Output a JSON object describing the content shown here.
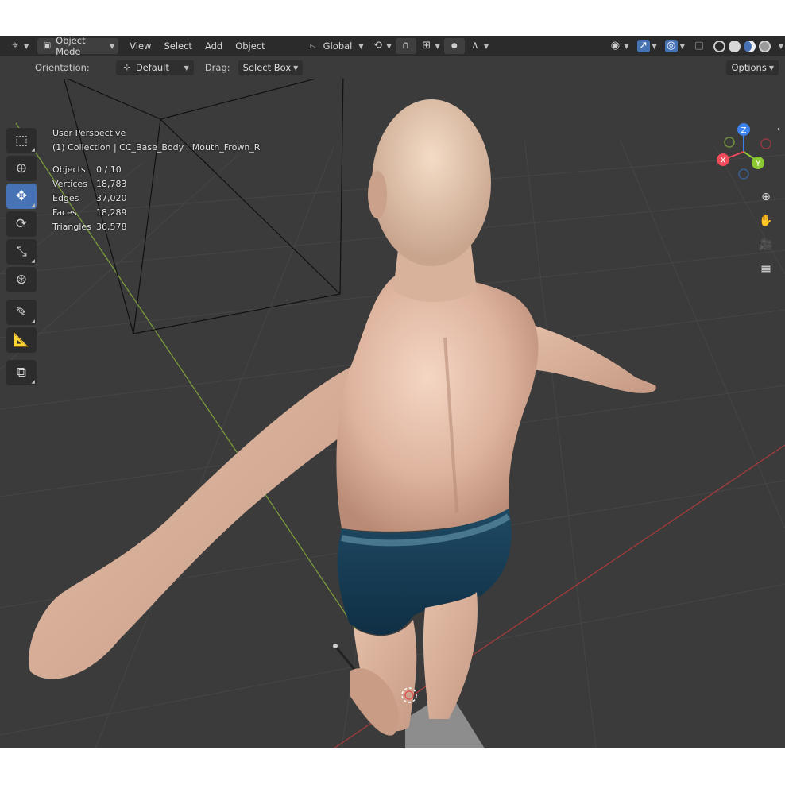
{
  "header": {
    "mode": "Object Mode",
    "menus": [
      "View",
      "Select",
      "Add",
      "Object"
    ],
    "transform_orientation": "Global",
    "options_label": "Options"
  },
  "subbar": {
    "orientation_label": "Orientation:",
    "orientation_value": "Default",
    "drag_label": "Drag:",
    "drag_value": "Select Box"
  },
  "overlay": {
    "view_name": "User Perspective",
    "collection_path": "(1) Collection | CC_Base_Body : Mouth_Frown_R",
    "stats": [
      {
        "label": "Objects",
        "value": "0 / 10"
      },
      {
        "label": "Vertices",
        "value": "18,783"
      },
      {
        "label": "Edges",
        "value": "37,020"
      },
      {
        "label": "Faces",
        "value": "18,289"
      },
      {
        "label": "Triangles",
        "value": "36,578"
      }
    ]
  },
  "gizmo": {
    "z": "Z",
    "y": "Y",
    "x": "X"
  },
  "colors": {
    "accent": "#4772b3",
    "axis_x": "#ee4b5b",
    "axis_y": "#8bc834",
    "axis_z": "#3c82ee",
    "header_bg": "#2b2b2b",
    "viewport_bg": "#3b3b3b"
  },
  "tools": [
    "select-box-icon",
    "cursor-icon",
    "move-icon",
    "rotate-icon",
    "scale-icon",
    "transform-icon",
    "annotate-icon",
    "measure-icon",
    "add-cube-icon"
  ]
}
